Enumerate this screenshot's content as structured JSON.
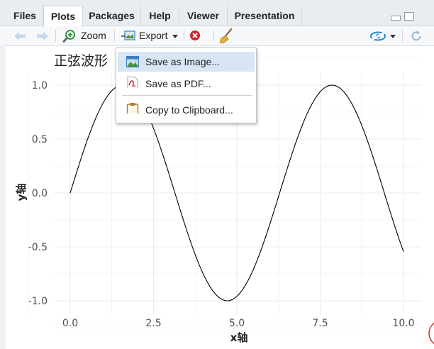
{
  "tabs": [
    {
      "label": "Files",
      "active": false
    },
    {
      "label": "Plots",
      "active": true
    },
    {
      "label": "Packages",
      "active": false
    },
    {
      "label": "Help",
      "active": false
    },
    {
      "label": "Viewer",
      "active": false
    },
    {
      "label": "Presentation",
      "active": false
    }
  ],
  "toolbar": {
    "zoom_label": "Zoom",
    "export_label": "Export"
  },
  "export_menu": {
    "items": [
      {
        "label": "Save as Image...",
        "icon": "image-icon",
        "highlighted": true
      },
      {
        "label": "Save as PDF...",
        "icon": "pdf-icon",
        "highlighted": false
      },
      {
        "label": "Copy to Clipboard...",
        "icon": "clipboard-icon",
        "highlighted": false
      }
    ]
  },
  "chart_data": {
    "type": "line",
    "title": "正弦波形",
    "xlabel": "x轴",
    "ylabel": "y轴",
    "xlim": [
      0,
      10
    ],
    "ylim": [
      -1,
      1
    ],
    "x_ticks": [
      "0.0",
      "2.5",
      "5.0",
      "7.5",
      "10.0"
    ],
    "y_ticks": [
      "1.0",
      "0.5",
      "0.0",
      "-0.5",
      "-1.0"
    ],
    "grid": true,
    "function": "y = sin(x)",
    "series": [
      {
        "color": "#000000",
        "x": [
          0,
          0.5,
          1,
          1.5,
          1.57,
          2,
          2.5,
          3,
          3.5,
          4,
          4.5,
          4.71,
          5,
          5.5,
          6,
          6.5,
          7,
          7.5,
          7.85,
          8,
          8.5,
          9,
          9.5,
          10
        ],
        "y": [
          0,
          0.479,
          0.841,
          0.997,
          1.0,
          0.909,
          0.598,
          0.141,
          -0.351,
          -0.757,
          -0.978,
          -1.0,
          -0.959,
          -0.706,
          -0.279,
          0.215,
          0.657,
          0.938,
          1.0,
          0.989,
          0.798,
          0.412,
          -0.075,
          -0.544
        ]
      }
    ]
  },
  "colors": {
    "tabbar_bg": "#e9edf2",
    "menu_highlight": "#d8e6f4",
    "grid": "#ebebeb",
    "accent_blue": "#1b8ad3"
  }
}
